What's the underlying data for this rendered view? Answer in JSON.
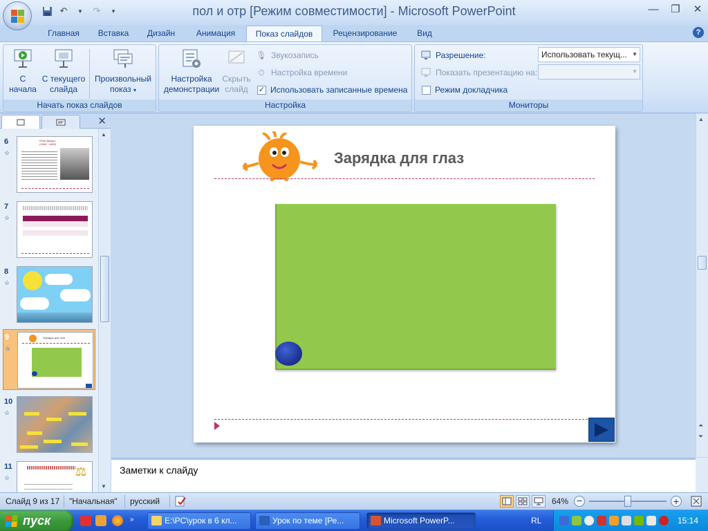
{
  "window": {
    "title": "пол и отр [Режим совместимости] - Microsoft PowerPoint"
  },
  "quick_access": {
    "save_icon": "save-icon",
    "undo_icon": "undo-icon",
    "redo_icon": "redo-icon",
    "customize_icon": "customize-qat-icon"
  },
  "tabs": [
    "Главная",
    "Вставка",
    "Дизайн",
    "Анимация",
    "Показ слайдов",
    "Рецензирование",
    "Вид"
  ],
  "active_tab": "Показ слайдов",
  "ribbon": {
    "start_group": {
      "label": "Начать показ слайдов",
      "from_start_line1": "С",
      "from_start_line2": "начала",
      "from_current_line1": "С текущего",
      "from_current_line2": "слайда",
      "custom_line1": "Произвольный",
      "custom_line2": "показ"
    },
    "setup_group": {
      "label": "Настройка",
      "setup_line1": "Настройка",
      "setup_line2": "демонстрации",
      "hide_line1": "Скрыть",
      "hide_line2": "слайд",
      "record_narration": "Звукозапись",
      "rehearse_timings": "Настройка времени",
      "use_timings": "Использовать записанные времена",
      "use_timings_checked": true
    },
    "monitors_group": {
      "label": "Мониторы",
      "resolution_label": "Разрешение:",
      "resolution_value": "Использовать текущ...",
      "show_on_label": "Показать презентацию на:",
      "show_on_value": "",
      "presenter_view": "Режим докладчика",
      "presenter_view_checked": false
    }
  },
  "slide_pane": {
    "thumbnails": [
      {
        "number": "6",
        "text_title": "Рене Декарт",
        "text_dates": "(1596 - 1650)"
      },
      {
        "number": "7",
        "text_title": ""
      },
      {
        "number": "8",
        "text_title": ""
      },
      {
        "number": "9",
        "text_title": "Зарядка для глаз"
      },
      {
        "number": "10",
        "text_title": ""
      },
      {
        "number": "11",
        "text_title": ""
      }
    ],
    "selected_index": 3
  },
  "slide": {
    "title": "Зарядка для глаз",
    "colors": {
      "green_rect": "#92c94c",
      "ball": "#1f3fa8",
      "divider": "#c0336b",
      "nav_button": "#1c55a6",
      "mascot": "#f7941d"
    }
  },
  "notes": {
    "placeholder": "Заметки к слайду"
  },
  "status": {
    "slide_counter": "Слайд 9 из 17",
    "theme": "\"Начальная\"",
    "language": "русский",
    "zoom": "64%",
    "zoom_level_fraction": 0.5
  },
  "taskbar": {
    "start_label": "пуск",
    "tasks": [
      {
        "label": "E:\\PC\\урок в 6 кл...",
        "active": false
      },
      {
        "label": "Урок по теме [Ре...",
        "active": false
      },
      {
        "label": "Microsoft PowerP...",
        "active": true
      }
    ],
    "lang": "RL",
    "clock": "15:14"
  }
}
